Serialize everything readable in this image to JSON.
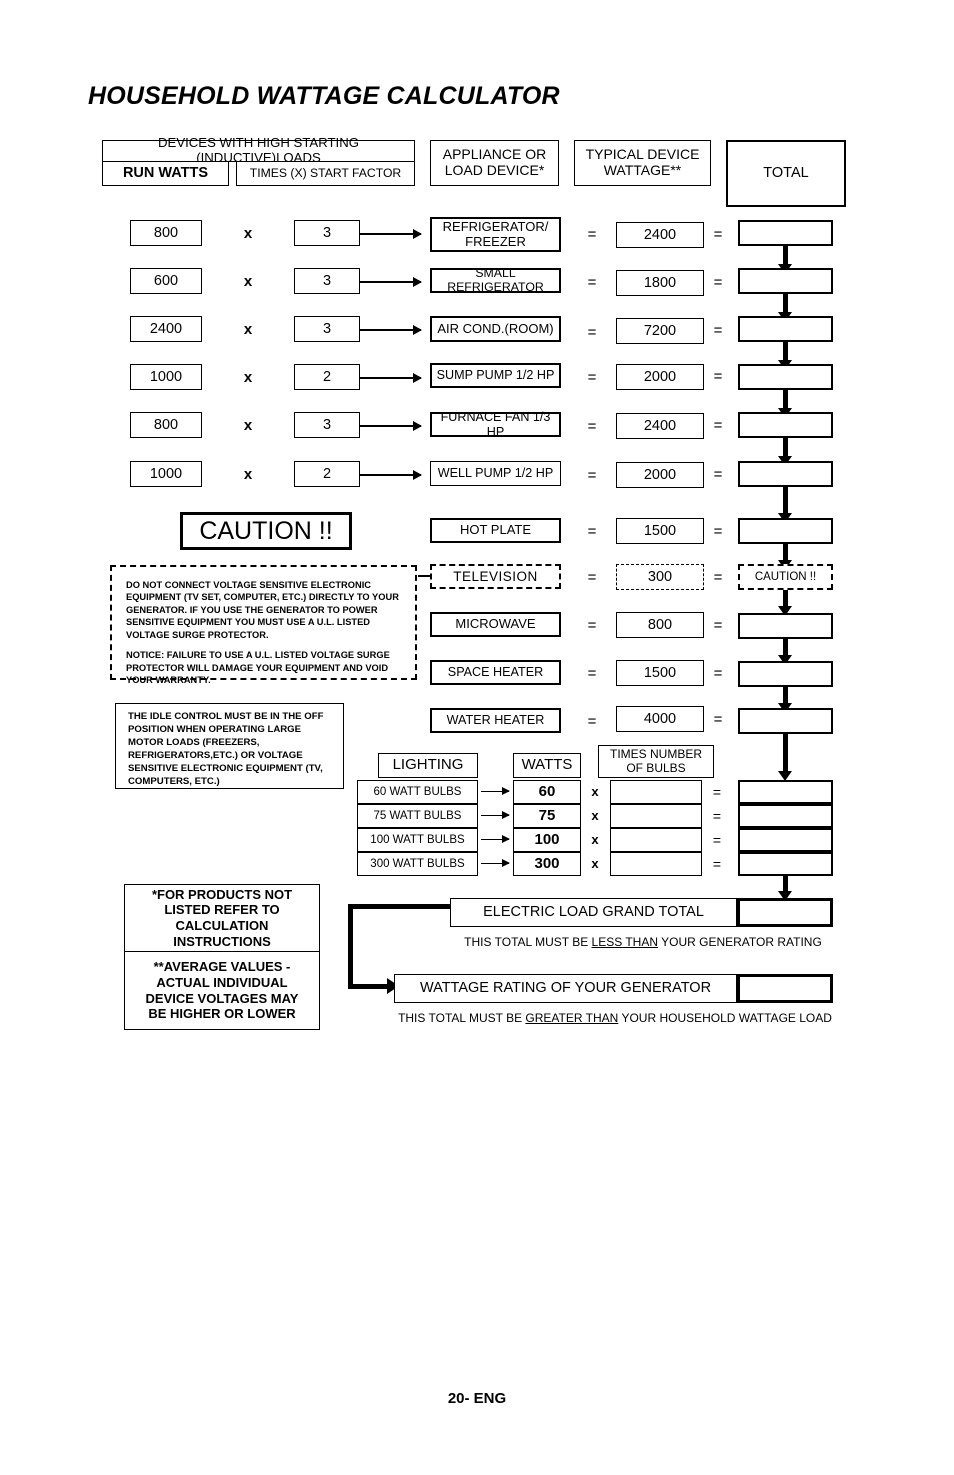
{
  "page_title": "HOUSEHOLD WATTAGE CALCULATOR",
  "footer": "20- ENG",
  "headers": {
    "inductive": "DEVICES WITH HIGH STARTING (INDUCTIVE)LOADS",
    "run_watts": "RUN WATTS",
    "start_factor": "TIMES (X) START FACTOR",
    "appliance_line1": "APPLIANCE OR",
    "appliance_line2": "LOAD DEVICE*",
    "typical_line1": "TYPICAL DEVICE",
    "typical_line2": "WATTAGE**",
    "total": "TOTAL"
  },
  "operators": {
    "times": "x",
    "equals": "=",
    "times_lower": "x"
  },
  "inductive_rows": [
    {
      "run_watts": "800",
      "factor": "3",
      "device": "REFRIGERATOR/\nFREEZER",
      "device_l1": "REFRIGERATOR/",
      "device_l2": "FREEZER",
      "wattage": "2400",
      "total": ""
    },
    {
      "run_watts": "600",
      "factor": "3",
      "device": "SMALL REFRIGERATOR",
      "device_l1": "SMALL REFRIGERATOR",
      "device_l2": "",
      "wattage": "1800",
      "total": ""
    },
    {
      "run_watts": "2400",
      "factor": "3",
      "device": "AIR COND.(ROOM)",
      "device_l1": "AIR COND.(ROOM)",
      "device_l2": "",
      "wattage": "7200",
      "total": ""
    },
    {
      "run_watts": "1000",
      "factor": "2",
      "device": "SUMP PUMP 1/2 HP",
      "device_l1": "SUMP PUMP 1/2 HP",
      "device_l2": "",
      "wattage": "2000",
      "total": ""
    },
    {
      "run_watts": "800",
      "factor": "3",
      "device": "FURNACE FAN 1/3 HP",
      "device_l1": "FURNACE FAN 1/3 HP",
      "device_l2": "",
      "wattage": "2400",
      "total": ""
    },
    {
      "run_watts": "1000",
      "factor": "2",
      "device": "WELL PUMP 1/2 HP",
      "device_l1": "WELL PUMP 1/2 HP",
      "device_l2": "",
      "wattage": "2000",
      "total": ""
    }
  ],
  "resistive_rows": [
    {
      "device": "HOT PLATE",
      "wattage": "1500",
      "total": "",
      "dashed": false
    },
    {
      "device": "TELEVISION",
      "wattage": "300",
      "total": "CAUTION !!",
      "dashed": true
    },
    {
      "device": "MICROWAVE",
      "wattage": "800",
      "total": "",
      "dashed": false
    },
    {
      "device": "SPACE HEATER",
      "wattage": "1500",
      "total": "",
      "dashed": false
    },
    {
      "device": "WATER HEATER",
      "wattage": "4000",
      "total": "",
      "dashed": false
    }
  ],
  "caution": {
    "title": "CAUTION !!",
    "paragraph1": "DO NOT CONNECT VOLTAGE SENSITIVE ELECTRONIC EQUIPMENT (TV SET, COMPUTER, ETC.) DIRECTLY TO YOUR GENERATOR. IF YOU USE THE GENERATOR TO POWER SENSITIVE EQUIPMENT YOU MUST USE A U.L. LISTED VOLTAGE SURGE PROTECTOR.",
    "paragraph2": "NOTICE:  FAILURE TO USE A U.L. LISTED VOLTAGE SURGE PROTECTOR WILL DAMAGE YOUR EQUIPMENT AND VOID YOUR WARRANTY."
  },
  "idle_control": "THE IDLE CONTROL MUST BE IN THE OFF POSITION WHEN OPERATING LARGE MOTOR LOADS (FREEZERS, REFRIGERATORS,ETC.) OR VOLTAGE SENSITIVE ELECTRONIC EQUIPMENT (TV, COMPUTERS, ETC.)",
  "lighting": {
    "header_lighting": "LIGHTING",
    "header_watts": "WATTS",
    "header_bulbs_l1": "TIMES NUMBER",
    "header_bulbs_l2": "OF BULBS",
    "rows": [
      {
        "name": "60 WATT BULBS",
        "watts": "60",
        "bulbs": "",
        "total": ""
      },
      {
        "name": "75 WATT BULBS",
        "watts": "75",
        "bulbs": "",
        "total": ""
      },
      {
        "name": "100 WATT BULBS",
        "watts": "100",
        "bulbs": "",
        "total": ""
      },
      {
        "name": "300 WATT BULBS",
        "watts": "300",
        "bulbs": "",
        "total": ""
      }
    ]
  },
  "notes": {
    "note1_l1": "*FOR PRODUCTS NOT",
    "note1_l2": "LISTED REFER TO",
    "note1_l3": "CALCULATION",
    "note1_l4": "INSTRUCTIONS",
    "note2_l1": "**AVERAGE VALUES -",
    "note2_l2": "ACTUAL INDIVIDUAL",
    "note2_l3": "DEVICE VOLTAGES MAY",
    "note2_l4": "BE HIGHER OR LOWER"
  },
  "totals": {
    "grand_total_label": "ELECTRIC LOAD GRAND TOTAL",
    "grand_total_value": "",
    "grand_note_pre": "THIS TOTAL MUST BE ",
    "grand_note_emph": "LESS THAN",
    "grand_note_post": " YOUR GENERATOR RATING",
    "generator_label": "WATTAGE RATING OF YOUR GENERATOR",
    "generator_value": "",
    "generator_note_pre": "THIS TOTAL MUST BE ",
    "generator_note_emph": "GREATER THAN",
    "generator_note_post": " YOUR HOUSEHOLD WATTAGE LOAD"
  },
  "colors": {
    "ink": "#000000",
    "paper": "#ffffff"
  }
}
